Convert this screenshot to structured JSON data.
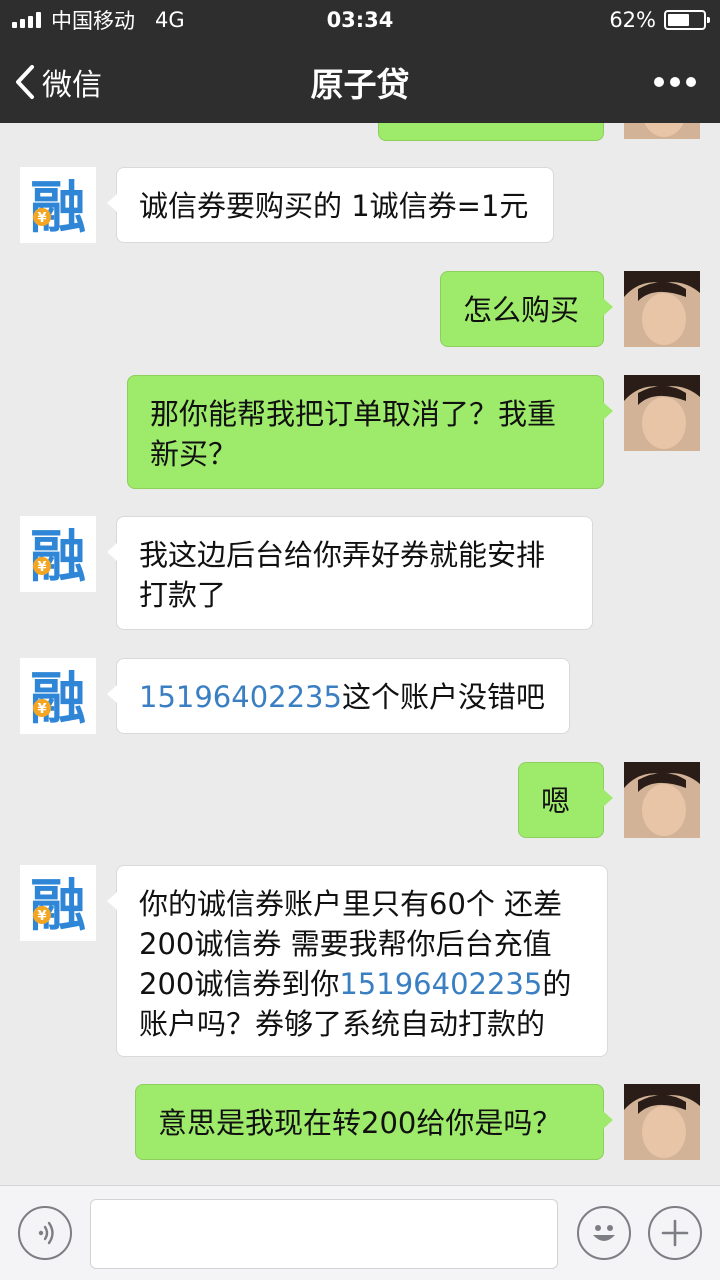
{
  "status_bar": {
    "carrier": "中国移动",
    "network": "4G",
    "time": "03:34",
    "battery": "62%",
    "battery_level": 0.62
  },
  "header": {
    "back_label": "微信",
    "title": "原子贷",
    "more_icon": "more-dots-icon"
  },
  "contacts": {
    "bot_avatar_glyph": "融",
    "bot_avatar_badge": "¥"
  },
  "messages": [
    {
      "from": "user",
      "text": ""
    },
    {
      "from": "bot",
      "text": "诚信券要购买的 1诚信券=1元"
    },
    {
      "from": "user",
      "text": "怎么购买"
    },
    {
      "from": "user",
      "line1": "那你能帮我把订单取消了？我重",
      "line2": "新买？"
    },
    {
      "from": "bot",
      "line1": "我这边后台给你弄好券就能安排",
      "line2": "打款了"
    },
    {
      "from": "bot",
      "link": "15196402235",
      "rest": "这个账户没错吧"
    },
    {
      "from": "user",
      "text": "嗯"
    },
    {
      "from": "bot",
      "line1": "你的诚信券账户里只有60个 还差",
      "line2": "200诚信券  需要我帮你后台充值",
      "line3_prefix": "200诚信券到你",
      "line3_link": "15196402235",
      "line3_suffix": "的",
      "line4": "账户吗？券够了系统自动打款的"
    },
    {
      "from": "user",
      "text": "意思是我现在转200给你是吗？"
    }
  ],
  "input_bar": {
    "voice_icon": "voice-icon",
    "emoji_icon": "emoji-icon",
    "plus_icon": "plus-icon"
  },
  "colors": {
    "nav_bg": "#2e2e2e",
    "chat_bg": "#ebebeb",
    "user_bubble": "#9eea6a",
    "bot_bubble": "#ffffff",
    "link": "#3a7fc1"
  }
}
